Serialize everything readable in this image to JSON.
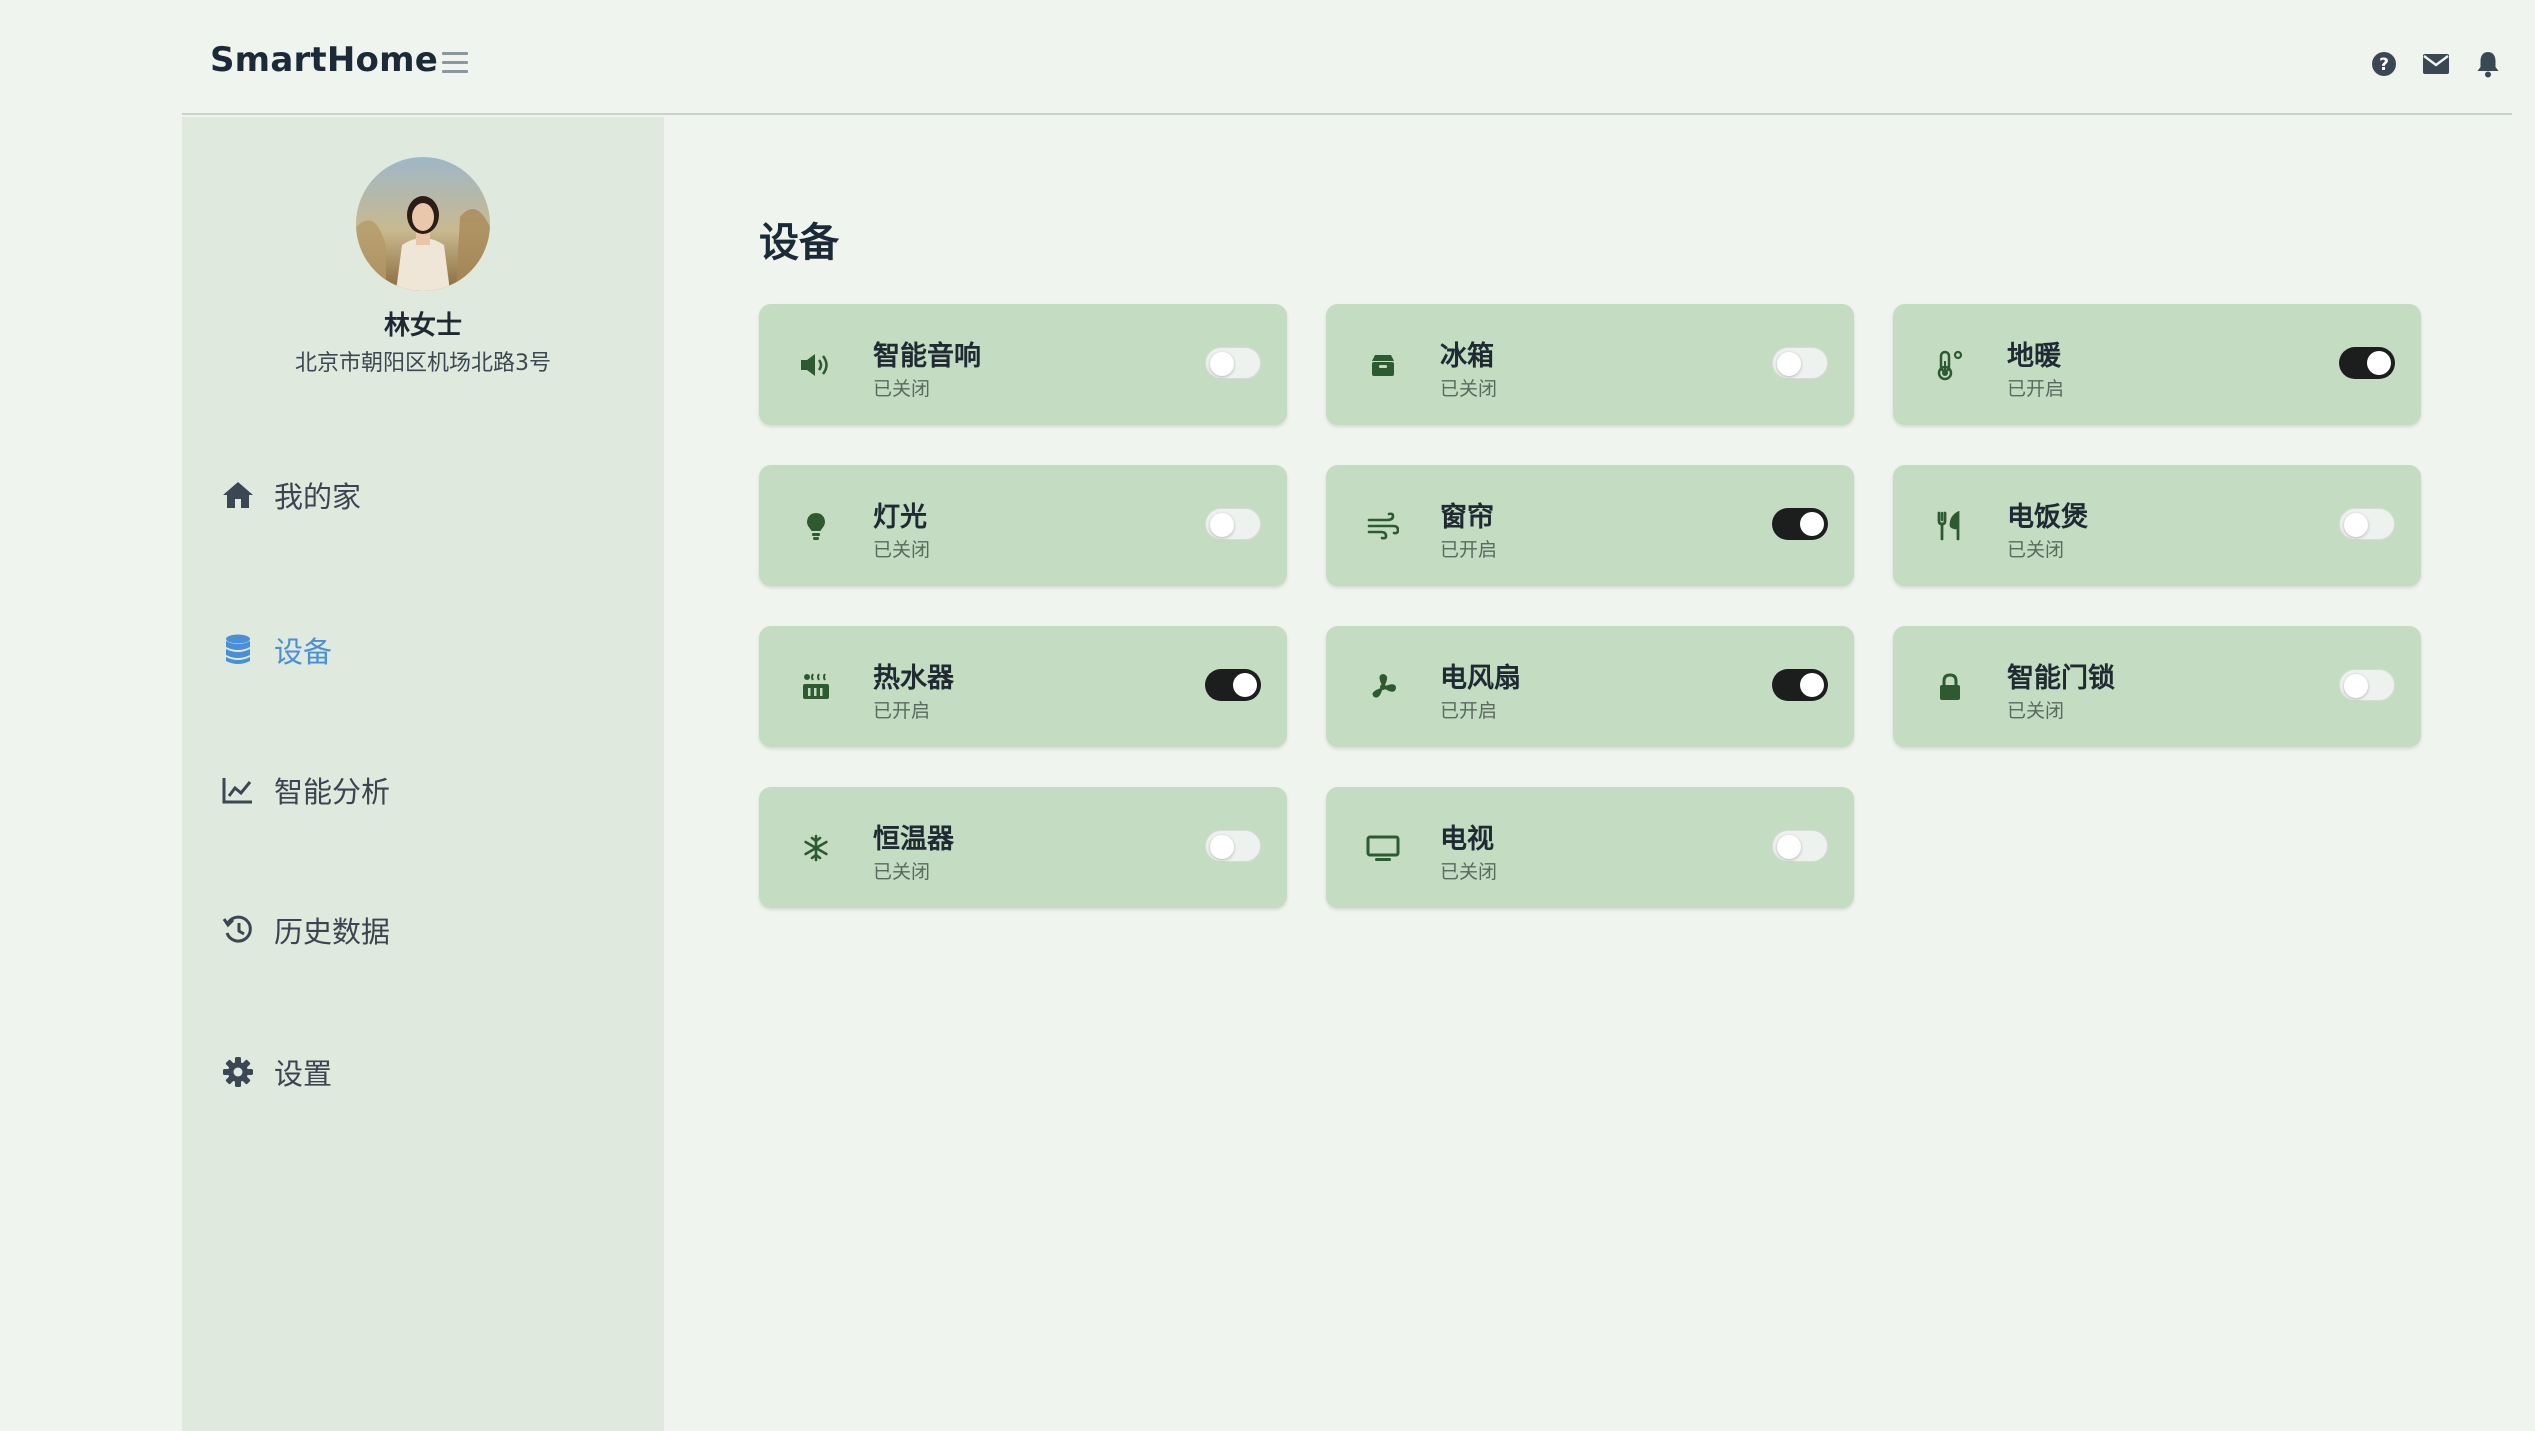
{
  "app": {
    "brand": "SmartHome"
  },
  "user": {
    "name": "林女士",
    "address": "北京市朝阳区机场北路3号"
  },
  "nav": {
    "items": [
      {
        "label": "我的家",
        "icon": "home-icon",
        "active": false
      },
      {
        "label": "设备",
        "icon": "database-icon",
        "active": true
      },
      {
        "label": "智能分析",
        "icon": "chart-line-icon",
        "active": false
      },
      {
        "label": "历史数据",
        "icon": "history-icon",
        "active": false
      },
      {
        "label": "设置",
        "icon": "gear-icon",
        "active": false
      }
    ]
  },
  "main": {
    "title": "设备"
  },
  "devices": [
    {
      "name": "智能音响",
      "status": "已关闭",
      "on": false,
      "icon": "speaker-icon"
    },
    {
      "name": "冰箱",
      "status": "已关闭",
      "on": false,
      "icon": "box-icon"
    },
    {
      "name": "地暖",
      "status": "已开启",
      "on": true,
      "icon": "thermometer-icon"
    },
    {
      "name": "灯光",
      "status": "已关闭",
      "on": false,
      "icon": "lightbulb-icon"
    },
    {
      "name": "窗帘",
      "status": "已开启",
      "on": true,
      "icon": "wind-icon"
    },
    {
      "name": "电饭煲",
      "status": "已关闭",
      "on": false,
      "icon": "utensils-icon"
    },
    {
      "name": "热水器",
      "status": "已开启",
      "on": true,
      "icon": "hot-tub-icon"
    },
    {
      "name": "电风扇",
      "status": "已开启",
      "on": true,
      "icon": "fan-icon"
    },
    {
      "name": "智能门锁",
      "status": "已关闭",
      "on": false,
      "icon": "lock-icon"
    },
    {
      "name": "恒温器",
      "status": "已关闭",
      "on": false,
      "icon": "snowflake-icon"
    },
    {
      "name": "电视",
      "status": "已关闭",
      "on": false,
      "icon": "tv-icon"
    }
  ],
  "colors": {
    "accent": "#4a90d9",
    "card": "#c4dcc2",
    "sidebar": "#dfe9dd",
    "background": "#f0f4ee",
    "icon": "#2e5a32"
  }
}
